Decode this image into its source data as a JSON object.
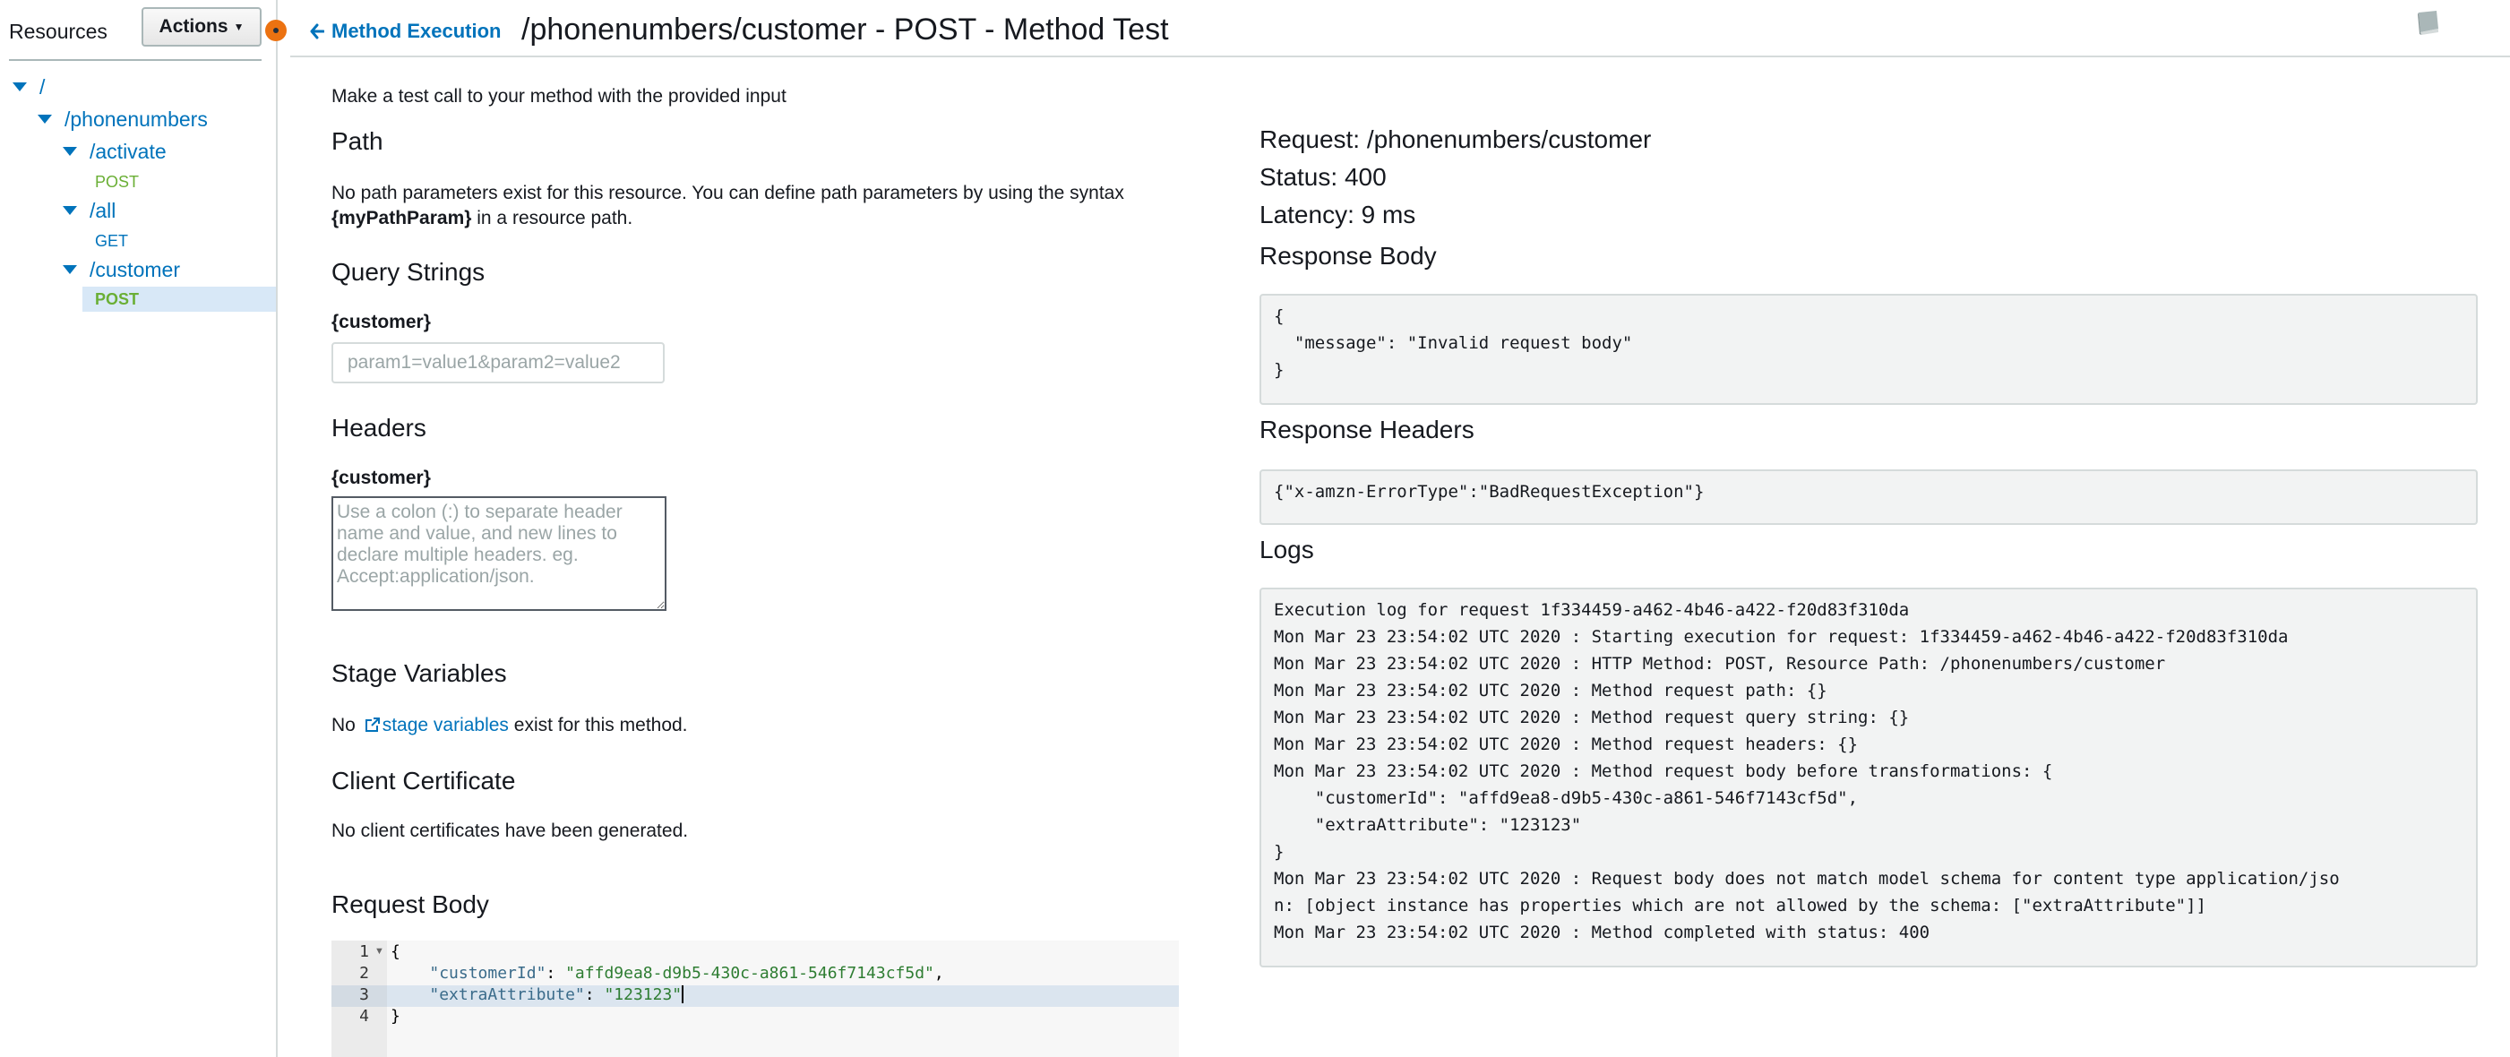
{
  "sidebar": {
    "title": "Resources",
    "actions_label": "Actions",
    "tree": {
      "root": "/",
      "phonenumbers": "/phonenumbers",
      "activate": "/activate",
      "activate_method": "POST",
      "all": "/all",
      "all_method": "GET",
      "customer": "/customer",
      "customer_method": "POST"
    }
  },
  "header": {
    "back_label": "Method Execution",
    "title": "/phonenumbers/customer - POST - Method Test"
  },
  "left": {
    "intro": "Make a test call to your method with the provided input",
    "path_heading": "Path",
    "path_text_1": "No path parameters exist for this resource. You can define path parameters by using the syntax",
    "path_param_syntax": "{myPathParam}",
    "path_text_2": " in a resource path.",
    "query_heading": "Query Strings",
    "query_label": "{customer}",
    "query_value": "",
    "query_placeholder": "param1=value1&param2=value2",
    "headers_heading": "Headers",
    "headers_label": "{customer}",
    "headers_value": "",
    "headers_placeholder": "Use a colon (:) to separate header name and value, and new lines to declare multiple headers. eg. Accept:application/json.",
    "stage_heading": "Stage Variables",
    "stage_prefix": "No ",
    "stage_link": "stage variables",
    "stage_suffix": " exist for this method.",
    "cert_heading": "Client Certificate",
    "cert_text": "No client certificates have been generated.",
    "body_heading": "Request Body",
    "body_lines": [
      {
        "num": "1",
        "open": "{"
      },
      {
        "num": "2",
        "key": "\"customerId\"",
        "sep": ": ",
        "val": "\"affd9ea8-d9b5-430c-a861-546f7143cf5d\"",
        "end": ","
      },
      {
        "num": "3",
        "key": "\"extraAttribute\"",
        "sep": ": ",
        "val": "\"123123\"",
        "end": ""
      },
      {
        "num": "4",
        "close": "}"
      }
    ]
  },
  "right": {
    "request": "Request: /phonenumbers/customer",
    "status": "Status: 400",
    "latency": "Latency: 9 ms",
    "response_body_heading": "Response Body",
    "response_body": "{\n  \"message\": \"Invalid request body\"\n}",
    "response_headers_heading": "Response Headers",
    "response_headers": "{\"x-amzn-ErrorType\":\"BadRequestException\"}",
    "logs_heading": "Logs",
    "logs": "Execution log for request 1f334459-a462-4b46-a422-f20d83f310da\nMon Mar 23 23:54:02 UTC 2020 : Starting execution for request: 1f334459-a462-4b46-a422-f20d83f310da\nMon Mar 23 23:54:02 UTC 2020 : HTTP Method: POST, Resource Path: /phonenumbers/customer\nMon Mar 23 23:54:02 UTC 2020 : Method request path: {}\nMon Mar 23 23:54:02 UTC 2020 : Method request query string: {}\nMon Mar 23 23:54:02 UTC 2020 : Method request headers: {}\nMon Mar 23 23:54:02 UTC 2020 : Method request body before transformations: {\n    \"customerId\": \"affd9ea8-d9b5-430c-a861-546f7143cf5d\",\n    \"extraAttribute\": \"123123\"\n}\nMon Mar 23 23:54:02 UTC 2020 : Request body does not match model schema for content type application/jso\nn: [object instance has properties which are not allowed by the schema: [\"extraAttribute\"]]\nMon Mar 23 23:54:02 UTC 2020 : Method completed with status: 400"
  },
  "colors": {
    "link": "#0073bb",
    "post": "#6aaf35",
    "accent": "#ec7211",
    "selected": "#d8e8f7"
  },
  "icons": {
    "back": "arrow-left-icon",
    "book": "book-icon",
    "external": "external-link-icon",
    "expand": "caret-down-icon"
  }
}
